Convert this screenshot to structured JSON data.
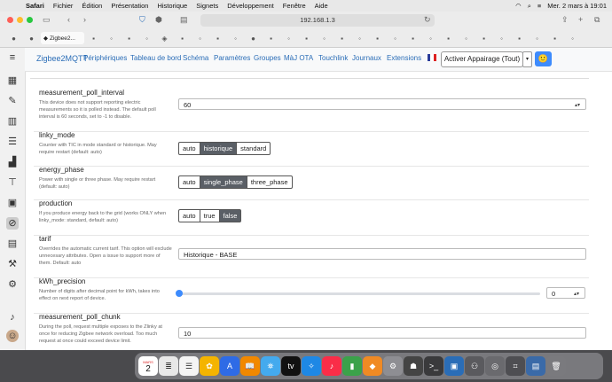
{
  "menubar": {
    "items": [
      "Safari",
      "Fichier",
      "Édition",
      "Présentation",
      "Historique",
      "Signets",
      "Développement",
      "Fenêtre",
      "Aide"
    ],
    "datetime": "Mer. 2 mars à 19:01"
  },
  "browser": {
    "url": "192.168.1.3",
    "active_tab": "Zigbee2..."
  },
  "app": {
    "brand": "Zigbee2MQTT",
    "nav": [
      "Périphériques",
      "Tableau de bord",
      "Schéma",
      "Paramètres",
      "Groupes",
      "MàJ OTA",
      "Touchlink",
      "Journaux",
      "Extensions"
    ],
    "pair_button": "Activer Appairage (Tout)",
    "smile": "🙂"
  },
  "settings": [
    {
      "title": "measurement_poll_interval",
      "desc": "This device does not support reporting electric measurements so it is polled instead. The default poll interval is 60 seconds, set to -1 to disable.",
      "value": "60"
    },
    {
      "title": "linky_mode",
      "desc": "Counter with TIC in mode standard or historique. May require restart (default: auto)",
      "options": [
        "auto",
        "historique",
        "standard"
      ],
      "selected": "historique"
    },
    {
      "title": "energy_phase",
      "desc": "Power with single or three phase. May require restart (default: auto)",
      "options": [
        "auto",
        "single_phase",
        "three_phase"
      ],
      "selected": "single_phase"
    },
    {
      "title": "production",
      "desc": "If you produce energy back to the grid (works ONLY when linky_mode: standard, default: auto)",
      "options": [
        "auto",
        "true",
        "false"
      ],
      "selected": "false"
    },
    {
      "title": "tarif",
      "desc": "Overrides the automatic current tarif. This option will exclude unnecesary attributes. Open a issue to support more of them. Default: auto",
      "value": "Historique - BASE"
    },
    {
      "title": "kWh_precision",
      "desc": "Number of digits after decimal point for kWh, takes into effect on next report of device.",
      "value": "0",
      "slider_fraction": 0
    },
    {
      "title": "measurement_poll_chunk",
      "desc": "During the poll, request multiple exposes to the Zlinky at once for reducing Zigbee network overload. Too much request at once could exceed device limit.",
      "value": "10"
    }
  ],
  "dock": {
    "calendar_month": "MARS",
    "calendar_day": "2"
  }
}
